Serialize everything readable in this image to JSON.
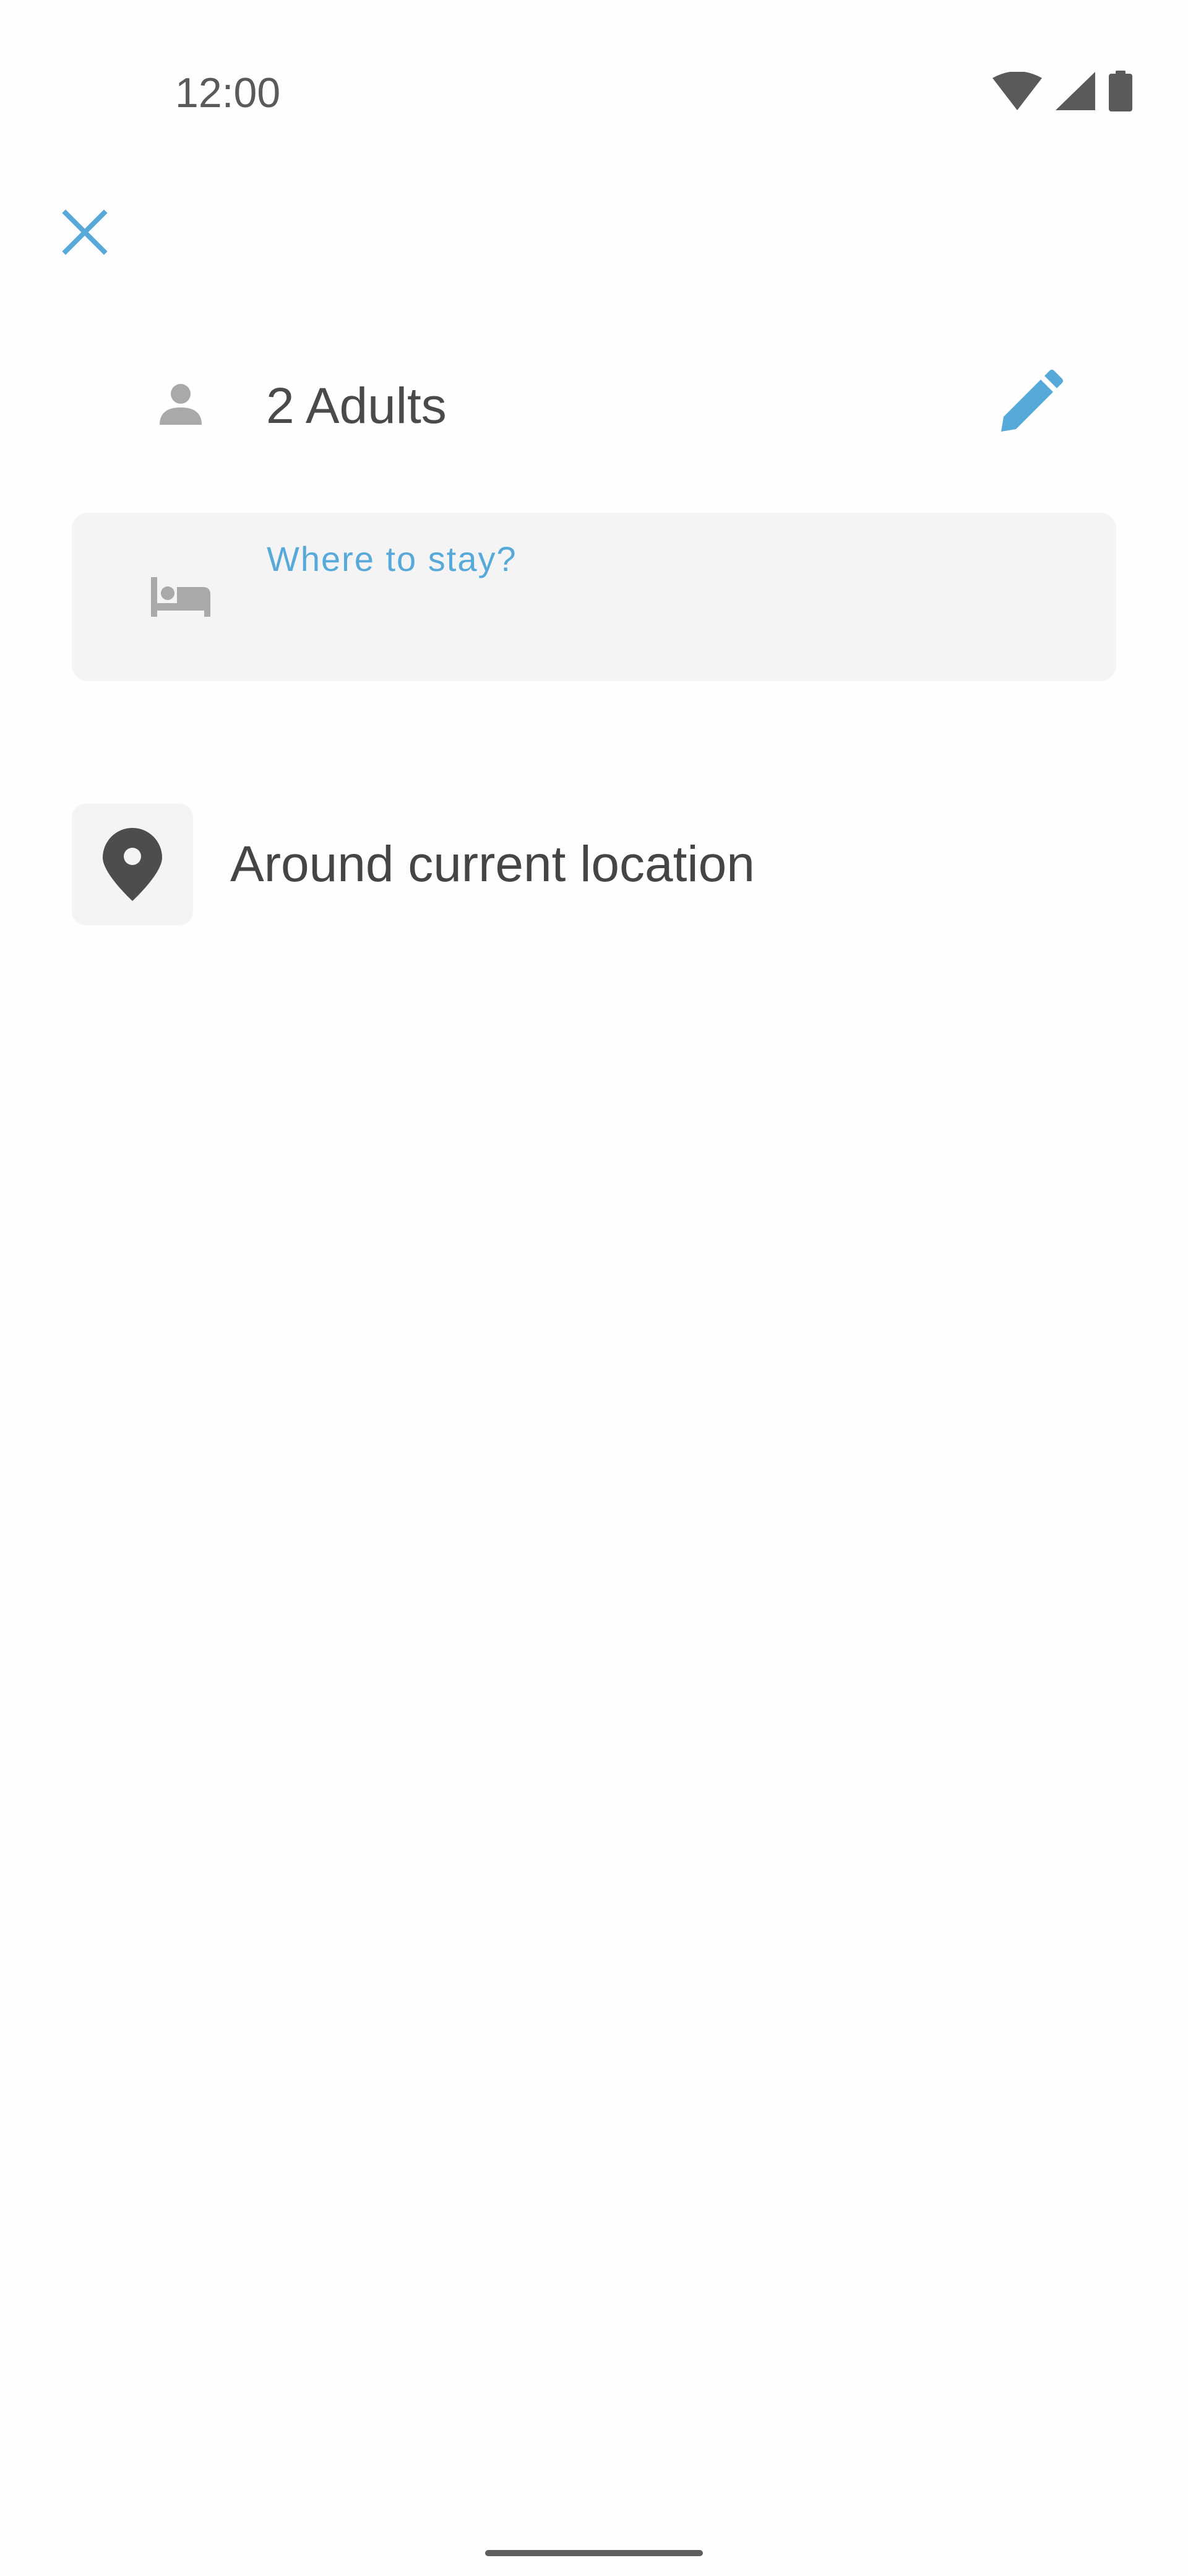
{
  "status_bar": {
    "time": "12:00",
    "icons": [
      "wifi-icon",
      "signal-icon",
      "battery-icon"
    ]
  },
  "toolbar": {
    "close_icon": "close-icon"
  },
  "guests": {
    "icon": "person-icon",
    "label": "2 Adults",
    "edit_icon": "pencil-icon"
  },
  "search": {
    "icon": "bed-icon",
    "label": "Where to stay?",
    "value": ""
  },
  "suggestions": [
    {
      "icon": "location-pin-icon",
      "label": "Around current location"
    }
  ],
  "colors": {
    "accent": "#57a9d9",
    "text_primary": "#454545",
    "icon_muted": "#a9a9a9",
    "field_bg": "#f4f4f4"
  }
}
